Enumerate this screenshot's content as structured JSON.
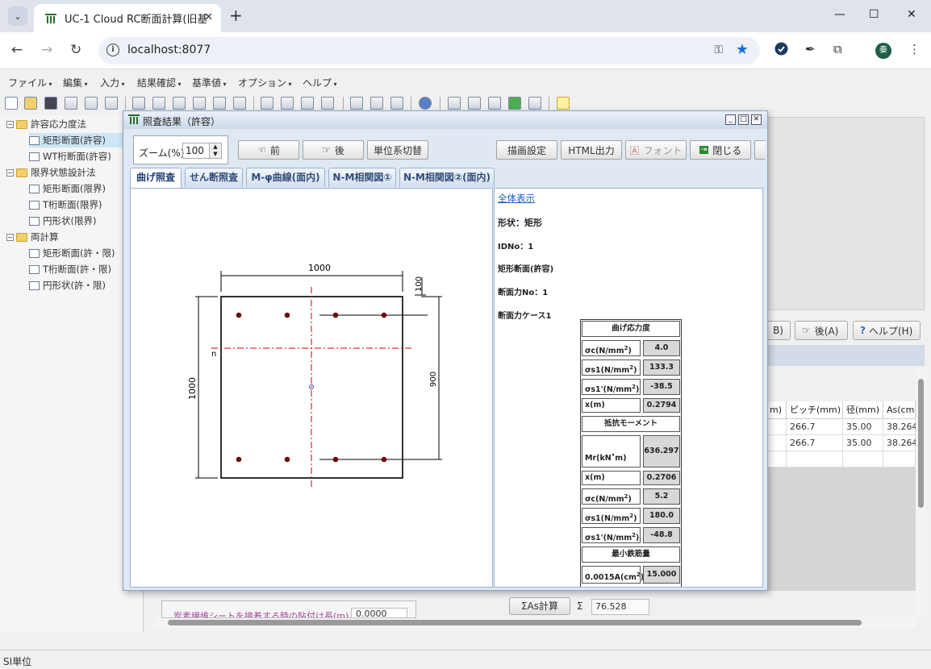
{
  "browser": {
    "tab_title": "UC-1 Cloud RC断面計算(旧基準",
    "url": "localhost:8077"
  },
  "menu": [
    "ファイル",
    "編集",
    "入力",
    "結果確認",
    "基準値",
    "オプション",
    "ヘルプ"
  ],
  "tree": [
    {
      "label": "許容応力度法",
      "type": "folder",
      "level": 0
    },
    {
      "label": "矩形断面(許容)",
      "type": "doc",
      "level": 1,
      "selected": true
    },
    {
      "label": "WT桁断面(許容)",
      "type": "doc",
      "level": 1
    },
    {
      "label": "限界状態設計法",
      "type": "folder",
      "level": 0
    },
    {
      "label": "矩形断面(限界)",
      "type": "doc",
      "level": 1
    },
    {
      "label": "T桁断面(限界)",
      "type": "doc",
      "level": 1
    },
    {
      "label": "円形状(限界)",
      "type": "doc",
      "level": 1
    },
    {
      "label": "両計算",
      "type": "folder",
      "level": 0
    },
    {
      "label": "矩形断面(許・限)",
      "type": "doc",
      "level": 1
    },
    {
      "label": "T桁断面(許・限)",
      "type": "doc",
      "level": 1
    },
    {
      "label": "円形状(許・限)",
      "type": "doc",
      "level": 1
    }
  ],
  "background": {
    "btn_prev_partial": "B)",
    "btn_next": "後(A)",
    "btn_help": "ヘルプ(H)",
    "grid_headers": [
      "m)",
      "ピッチ(mm)",
      "径(mm)",
      "As(cm"
    ],
    "grid_rows": [
      [
        "",
        "266.7",
        "35.00",
        "38.264"
      ],
      [
        "",
        "266.7",
        "35.00",
        "38.264"
      ]
    ],
    "bottom_field_label": "炭素繊維シートを接着する時の貼付け長(m)",
    "bottom_field_value": "0.0000",
    "sum_button": "ΣAs計算",
    "sum_symbol": "Σ",
    "sum_value": "76.528"
  },
  "status": "SI単位",
  "dialog": {
    "title": "照査結果（許容）",
    "zoom_label": "ズーム(%)",
    "zoom_value": "100",
    "buttons": {
      "prev": "前",
      "next": "後",
      "unit": "単位系切替",
      "draw": "描画設定",
      "html": "HTML出力",
      "font": "フォント",
      "close": "閉じる"
    },
    "tabs": [
      "曲げ照査",
      "せん断照査",
      "M-φ曲線(面内)",
      "N-M相関図①",
      "N-M相関図②(面内)"
    ],
    "drawing": {
      "width_label": "1000",
      "height_label": "1000",
      "cover_label": "100",
      "effective_label": "900",
      "neutral_label": "n"
    },
    "result": {
      "show_all": "全体表示",
      "shape": "形状：矩形",
      "id": "IDNo：1",
      "section": "矩形断面(許容)",
      "force_no": "断面力No：1",
      "force_case": "断面力ケース1",
      "h_stress": "曲げ応力度",
      "sigma_c_label": "σc(N/mm",
      "sigma_c": "4.0",
      "sigma_s1_label": "σs1(N/mm",
      "sigma_s1": "133.3",
      "sigma_s1p_label": "σs1'(N/mm",
      "sigma_s1p": "-38.5",
      "x_label": "x(m)",
      "x": "0.2794",
      "h_moment": "抵抗モーメント",
      "mr_label": "Mr(kN",
      "mr_unit": "m)",
      "mr": "636.297",
      "x2": "0.2706",
      "sigma_c2": "5.2",
      "sigma_s12": "180.0",
      "sigma_s1p2": "-48.8",
      "h_min": "最小鉄筋量",
      "amin_label": "0.0015A(cm",
      "amin": "15.000",
      "sq": "2",
      "sq_close": ")"
    }
  }
}
